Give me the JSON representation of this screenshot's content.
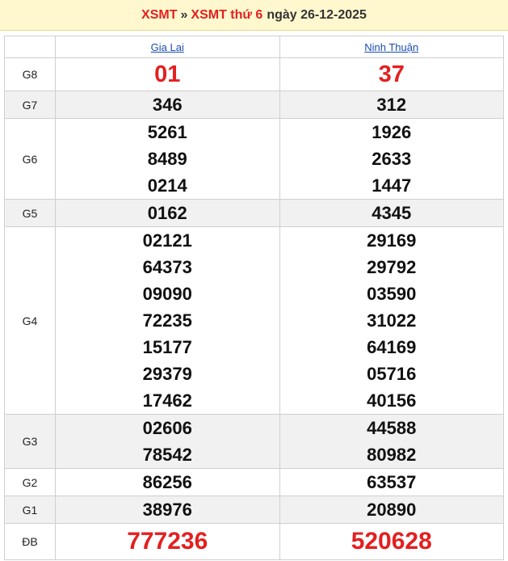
{
  "header": {
    "link1": "XSMT",
    "separator": "»",
    "link2": "XSMT thứ 6",
    "date_text": "ngày 26-12-2025"
  },
  "columns": [
    "Gia Lai",
    "Ninh Thuận"
  ],
  "prizes": [
    {
      "label": "G8",
      "gia_lai": [
        "01"
      ],
      "ninh_thuan": [
        "37"
      ]
    },
    {
      "label": "G7",
      "gia_lai": [
        "346"
      ],
      "ninh_thuan": [
        "312"
      ]
    },
    {
      "label": "G6",
      "gia_lai": [
        "5261",
        "8489",
        "0214"
      ],
      "ninh_thuan": [
        "1926",
        "2633",
        "1447"
      ]
    },
    {
      "label": "G5",
      "gia_lai": [
        "0162"
      ],
      "ninh_thuan": [
        "4345"
      ]
    },
    {
      "label": "G4",
      "gia_lai": [
        "02121",
        "64373",
        "09090",
        "72235",
        "15177",
        "29379",
        "17462"
      ],
      "ninh_thuan": [
        "29169",
        "29792",
        "03590",
        "31022",
        "64169",
        "05716",
        "40156"
      ]
    },
    {
      "label": "G3",
      "gia_lai": [
        "02606",
        "78542"
      ],
      "ninh_thuan": [
        "44588",
        "80982"
      ]
    },
    {
      "label": "G2",
      "gia_lai": [
        "86256"
      ],
      "ninh_thuan": [
        "63537"
      ]
    },
    {
      "label": "G1",
      "gia_lai": [
        "38976"
      ],
      "ninh_thuan": [
        "20890"
      ]
    },
    {
      "label": "ĐB",
      "gia_lai": [
        "777236"
      ],
      "ninh_thuan": [
        "520628"
      ]
    }
  ],
  "colors": {
    "accent_red": "#e41f1f",
    "link_blue": "#1a4db3",
    "header_bg": "#fff8cf",
    "alt_row_bg": "#f1f1f1"
  }
}
